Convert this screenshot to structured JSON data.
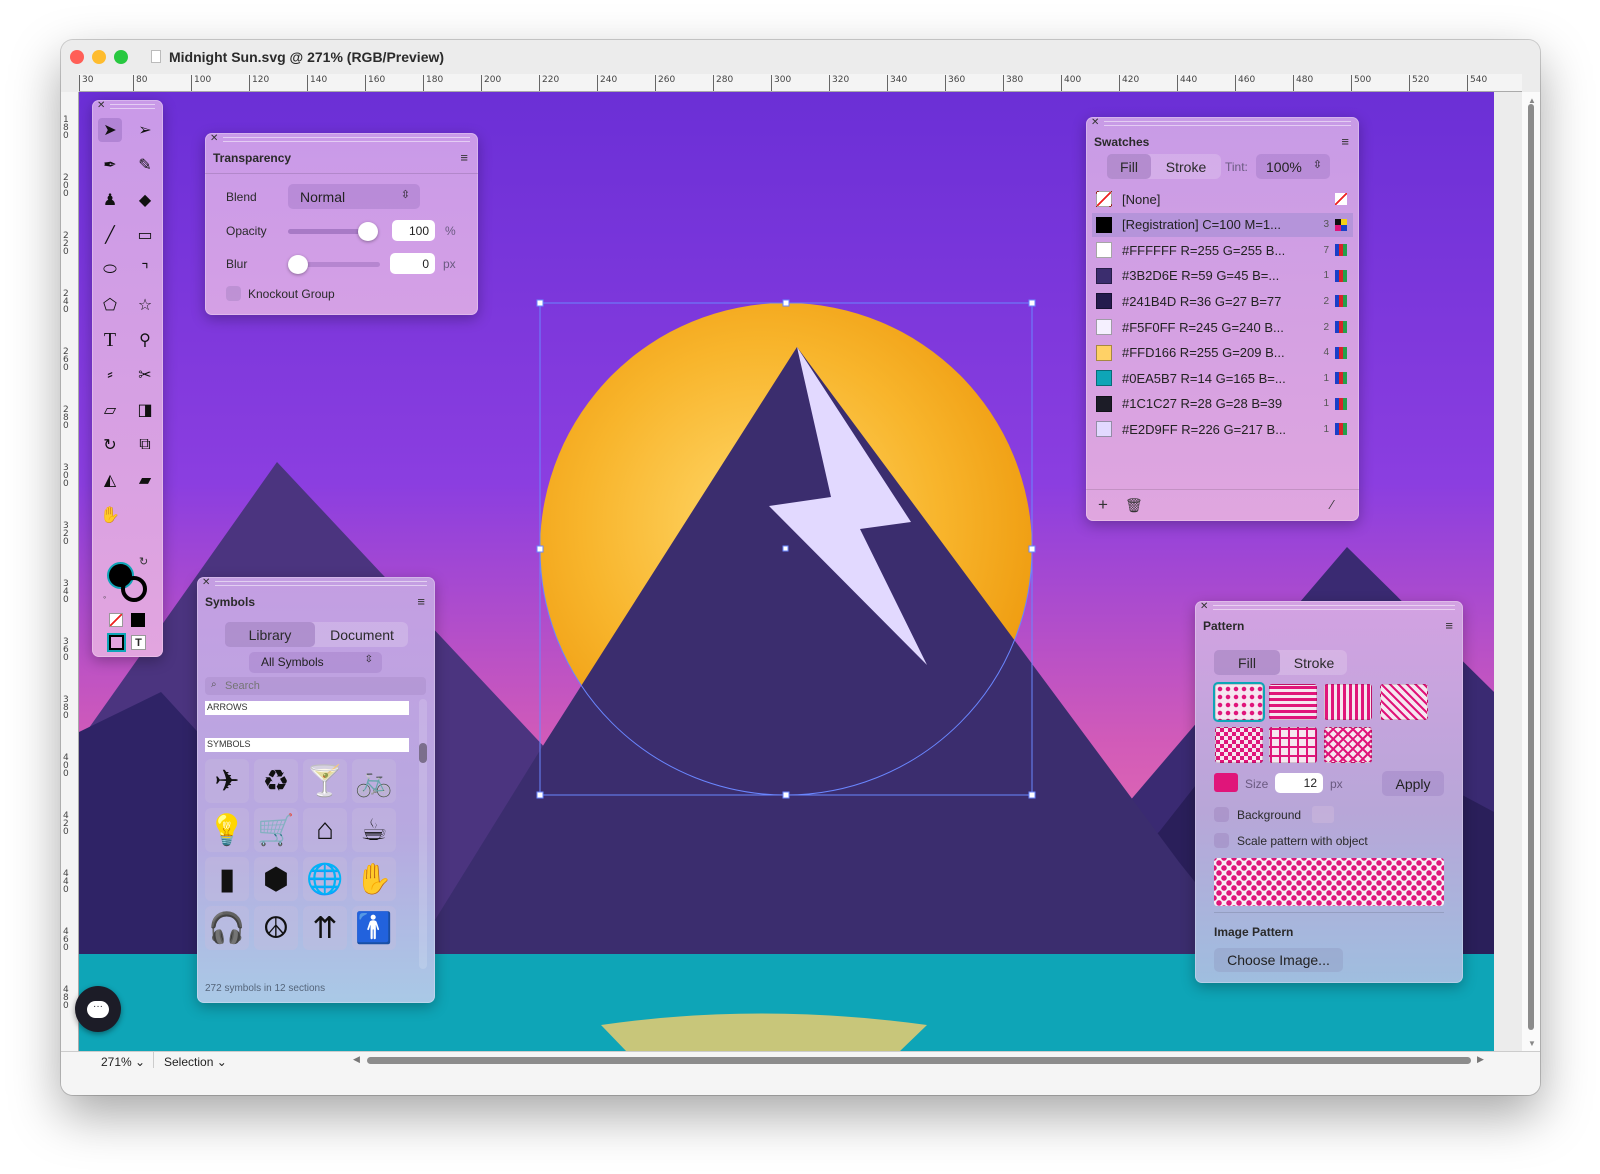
{
  "window": {
    "title": "Midnight Sun.svg @ 271% (RGB/Preview)"
  },
  "ruler": {
    "h_labels": [
      "30",
      "80",
      "100",
      "120",
      "140",
      "160",
      "180",
      "200",
      "220",
      "240",
      "260",
      "280",
      "300",
      "320",
      "340",
      "360",
      "380",
      "400",
      "420",
      "440",
      "460",
      "480",
      "500",
      "520",
      "540"
    ],
    "v_labels": [
      "180",
      "200",
      "220",
      "240",
      "260",
      "280",
      "300",
      "320",
      "340",
      "360",
      "380",
      "400",
      "420",
      "440",
      "460",
      "480"
    ]
  },
  "tools_panel": {
    "icons": [
      "selection-arrow-icon",
      "direct-selection-icon",
      "pen-icon",
      "pencil-icon",
      "people-icon",
      "eraser-icon",
      "line-icon",
      "rectangle-icon",
      "ellipse-icon",
      "corner-icon",
      "polygon-icon",
      "star-icon",
      "text-icon",
      "zoom-icon",
      "eyedropper-icon",
      "scissors-icon",
      "ruler-icon",
      "gradient-icon",
      "rotate-icon",
      "scale-icon",
      "reflect-icon",
      "shear-icon",
      "hand-icon"
    ],
    "text_tool_glyph": "T",
    "text_box_glyph": "T"
  },
  "transparency": {
    "title": "Transparency",
    "blend_label": "Blend",
    "blend_value": "Normal",
    "opacity_label": "Opacity",
    "opacity_value": "100",
    "opacity_unit": "%",
    "opacity_fraction": 1.0,
    "blur_label": "Blur",
    "blur_value": "0",
    "blur_unit": "px",
    "blur_fraction": 0.0,
    "knockout_label": "Knockout Group"
  },
  "swatches": {
    "title": "Swatches",
    "tab_fill": "Fill",
    "tab_stroke": "Stroke",
    "tint_label": "Tint:",
    "tint_value": "100%",
    "items": [
      {
        "name": "[None]",
        "count": "",
        "color": "none"
      },
      {
        "name": "[Registration] C=100 M=1...",
        "count": "3",
        "color": "#000000"
      },
      {
        "name": "#FFFFFF R=255 G=255 B...",
        "count": "7",
        "color": "#FFFFFF"
      },
      {
        "name": "#3B2D6E R=59 G=45 B=...",
        "count": "1",
        "color": "#3B2D6E"
      },
      {
        "name": "#241B4D R=36 G=27 B=77",
        "count": "2",
        "color": "#241B4D"
      },
      {
        "name": "#F5F0FF R=245 G=240 B...",
        "count": "2",
        "color": "#F5F0FF"
      },
      {
        "name": "#FFD166 R=255 G=209 B...",
        "count": "4",
        "color": "#FFD166"
      },
      {
        "name": "#0EA5B7 R=14 G=165 B=...",
        "count": "1",
        "color": "#0EA5B7"
      },
      {
        "name": "#1C1C27 R=28 G=28 B=39",
        "count": "1",
        "color": "#1C1C27"
      },
      {
        "name": "#E2D9FF R=226 G=217 B...",
        "count": "1",
        "color": "#E2D9FF"
      }
    ]
  },
  "symbols": {
    "title": "Symbols",
    "tab_library": "Library",
    "tab_document": "Document",
    "dropdown_value": "All Symbols",
    "search_placeholder": "Search",
    "section_arrows": "ARROWS",
    "section_symbols": "SYMBOLS",
    "icons": [
      {
        "name": "airplane-icon",
        "glyph": "✈"
      },
      {
        "name": "recycle-icon",
        "glyph": "♻"
      },
      {
        "name": "martini-icon",
        "glyph": "🍸"
      },
      {
        "name": "bicycle-icon",
        "glyph": "🚲"
      },
      {
        "name": "lightbulb-icon",
        "glyph": "💡"
      },
      {
        "name": "cart-icon",
        "glyph": "🛒"
      },
      {
        "name": "hanger-icon",
        "glyph": "⌂"
      },
      {
        "name": "coffee-cup-icon",
        "glyph": "☕"
      },
      {
        "name": "door-icon",
        "glyph": "▮"
      },
      {
        "name": "package-icon",
        "glyph": "⬢"
      },
      {
        "name": "globe-icon",
        "glyph": "🌐"
      },
      {
        "name": "hand-icon",
        "glyph": "✋"
      },
      {
        "name": "headphones-icon",
        "glyph": "🎧"
      },
      {
        "name": "peace-icon",
        "glyph": "☮"
      },
      {
        "name": "up-arrows-icon",
        "glyph": "⇈"
      },
      {
        "name": "person-icon",
        "glyph": "🚹"
      }
    ],
    "footer": "272 symbols in 12 sections"
  },
  "pattern": {
    "title": "Pattern",
    "tab_fill": "Fill",
    "tab_stroke": "Stroke",
    "size_label": "Size",
    "size_value": "12",
    "size_unit": "px",
    "apply_label": "Apply",
    "background_label": "Background",
    "scale_label": "Scale pattern with object",
    "image_pattern_label": "Image Pattern",
    "choose_image_label": "Choose Image...",
    "color": "#E0157A"
  },
  "statusbar": {
    "zoom": "271%",
    "mode": "Selection"
  },
  "artwork": {
    "sky_top": "#6B2FD6",
    "sky_bottom": "#F07AB4",
    "sun_color": "#F5A623",
    "mountain_color": "#3B2D6E",
    "bolt_color": "#E2D9FF",
    "water_color": "#0EA5B7",
    "island_color": "#C8C67A"
  }
}
